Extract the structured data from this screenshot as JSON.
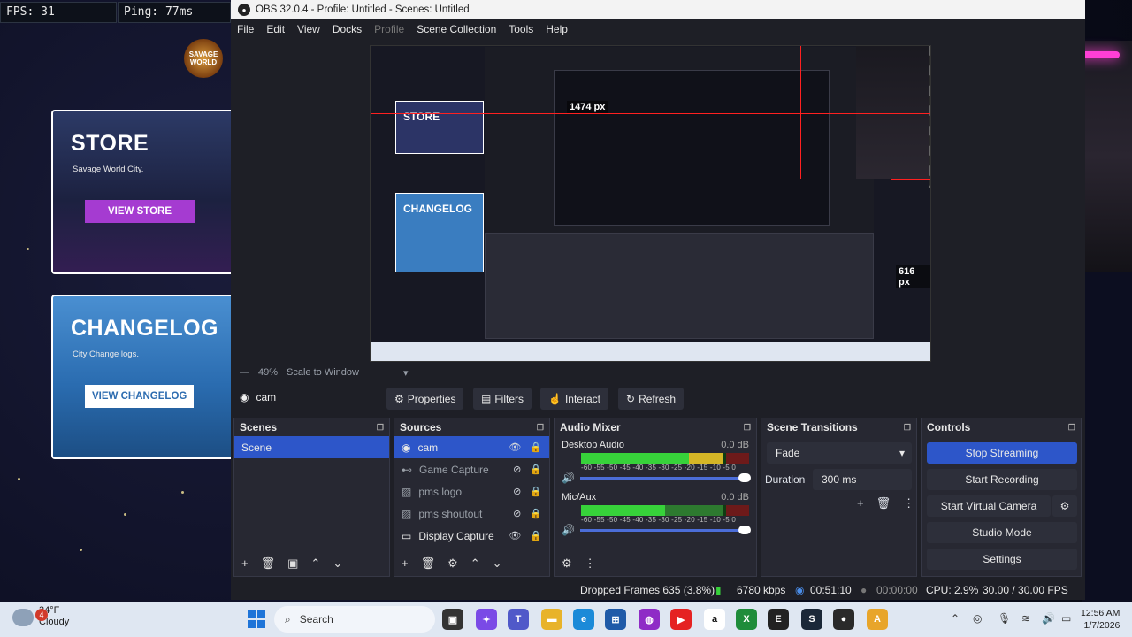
{
  "overlay": {
    "fps": "FPS: 31",
    "ping": "Ping: 77ms",
    "store": {
      "title": "STORE",
      "subtitle": "Savage World City.",
      "button": "VIEW STORE"
    },
    "changelog": {
      "title": "CHANGELOG",
      "subtitle": "City Change logs.",
      "button": "VIEW CHANGELOG"
    }
  },
  "obs": {
    "title": "OBS 32.0.4 - Profile: Untitled - Scenes: Untitled",
    "menu": [
      "File",
      "Edit",
      "View",
      "Docks",
      "Profile",
      "Scene Collection",
      "Tools",
      "Help"
    ],
    "preview_labels": {
      "width_px": "1474 px",
      "height_px": "616 px"
    },
    "zoom": {
      "percent": "49%",
      "mode": "Scale to Window"
    },
    "source_toolbar": {
      "source_name": "cam",
      "properties": "Properties",
      "filters": "Filters",
      "interact": "Interact",
      "refresh": "Refresh"
    },
    "scenes": {
      "title": "Scenes",
      "items": [
        "Scene"
      ]
    },
    "sources": {
      "title": "Sources",
      "items": [
        {
          "name": "cam",
          "visible": true
        },
        {
          "name": "Game Capture",
          "visible": false
        },
        {
          "name": "pms logo",
          "visible": false
        },
        {
          "name": "pms shoutout",
          "visible": false
        },
        {
          "name": "Display Capture",
          "visible": true
        }
      ]
    },
    "mixer": {
      "title": "Audio Mixer",
      "scale": "-60 -55 -50 -45 -40 -35 -30 -25 -20 -15 -10 -5 0",
      "tracks": [
        {
          "name": "Desktop Audio",
          "db": "0.0 dB"
        },
        {
          "name": "Mic/Aux",
          "db": "0.0 dB"
        }
      ]
    },
    "transitions": {
      "title": "Scene Transitions",
      "type": "Fade",
      "duration_label": "Duration",
      "duration": "300 ms"
    },
    "controls": {
      "title": "Controls",
      "stop_streaming": "Stop Streaming",
      "start_recording": "Start Recording",
      "start_virtual_camera": "Start Virtual Camera",
      "studio_mode": "Studio Mode",
      "settings": "Settings"
    },
    "status": {
      "dropped": "Dropped Frames 635 (3.8%)",
      "bitrate": "6780 kbps",
      "stream_time": "00:51:10",
      "rec_time": "00:00:00",
      "cpu": "CPU: 2.9%",
      "fps": "30.00 / 30.00 FPS"
    }
  },
  "taskbar": {
    "temp": "34°F",
    "condition": "Cloudy",
    "badge": "4",
    "search": "Search",
    "time": "12:56 AM",
    "date": "1/7/2026"
  },
  "colors": {
    "accent": "#2d56c9",
    "obs_bg": "#1e1f26",
    "meter_green": "#37d23a",
    "store_button": "#a53bd1"
  }
}
